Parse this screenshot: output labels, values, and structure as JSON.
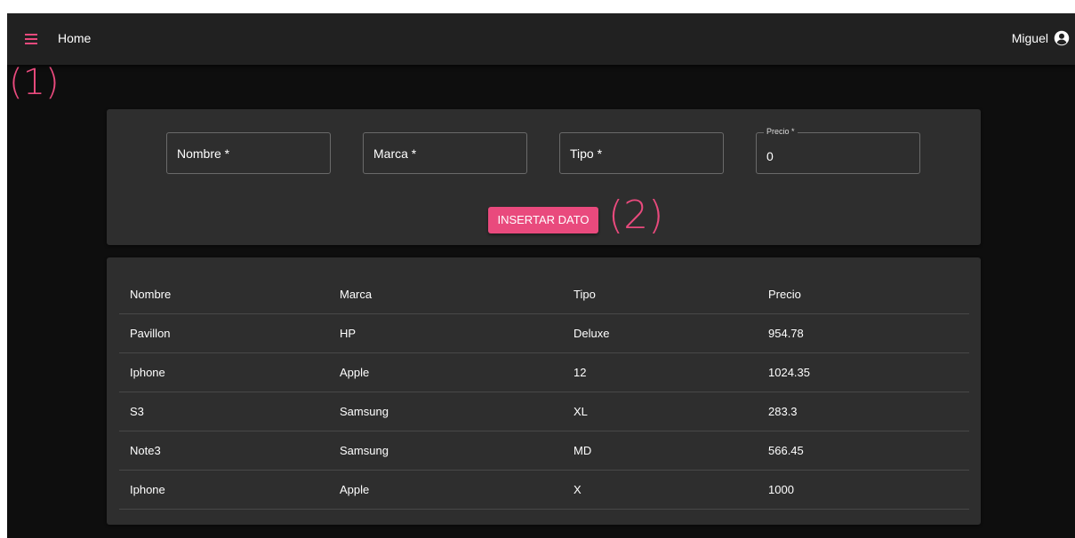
{
  "header": {
    "title": "Home",
    "user_name": "Miguel",
    "icons": {
      "menu": "menu-icon",
      "user": "account-circle-icon"
    }
  },
  "annotations": {
    "one": "(1)",
    "two": "(2)"
  },
  "form": {
    "nombre_label": "Nombre *",
    "marca_label": "Marca *",
    "tipo_label": "Tipo *",
    "precio_label": "Precio *",
    "precio_value": "0",
    "submit_label": "INSERTAR DATO"
  },
  "table": {
    "headers": [
      "Nombre",
      "Marca",
      "Tipo",
      "Precio"
    ],
    "rows": [
      [
        "Pavillon",
        "HP",
        "Deluxe",
        "954.78"
      ],
      [
        "Iphone",
        "Apple",
        "12",
        "1024.35"
      ],
      [
        "S3",
        "Samsung",
        "XL",
        "283.3"
      ],
      [
        "Note3",
        "Samsung",
        "MD",
        "566.45"
      ],
      [
        "Iphone",
        "Apple",
        "X",
        "1000"
      ]
    ]
  },
  "colors": {
    "accent": "#e94a7d",
    "app_background": "#0e0e0e",
    "topbar": "#212121",
    "card": "#2e2e2e",
    "divider": "#484848",
    "text": "#ffffff"
  }
}
